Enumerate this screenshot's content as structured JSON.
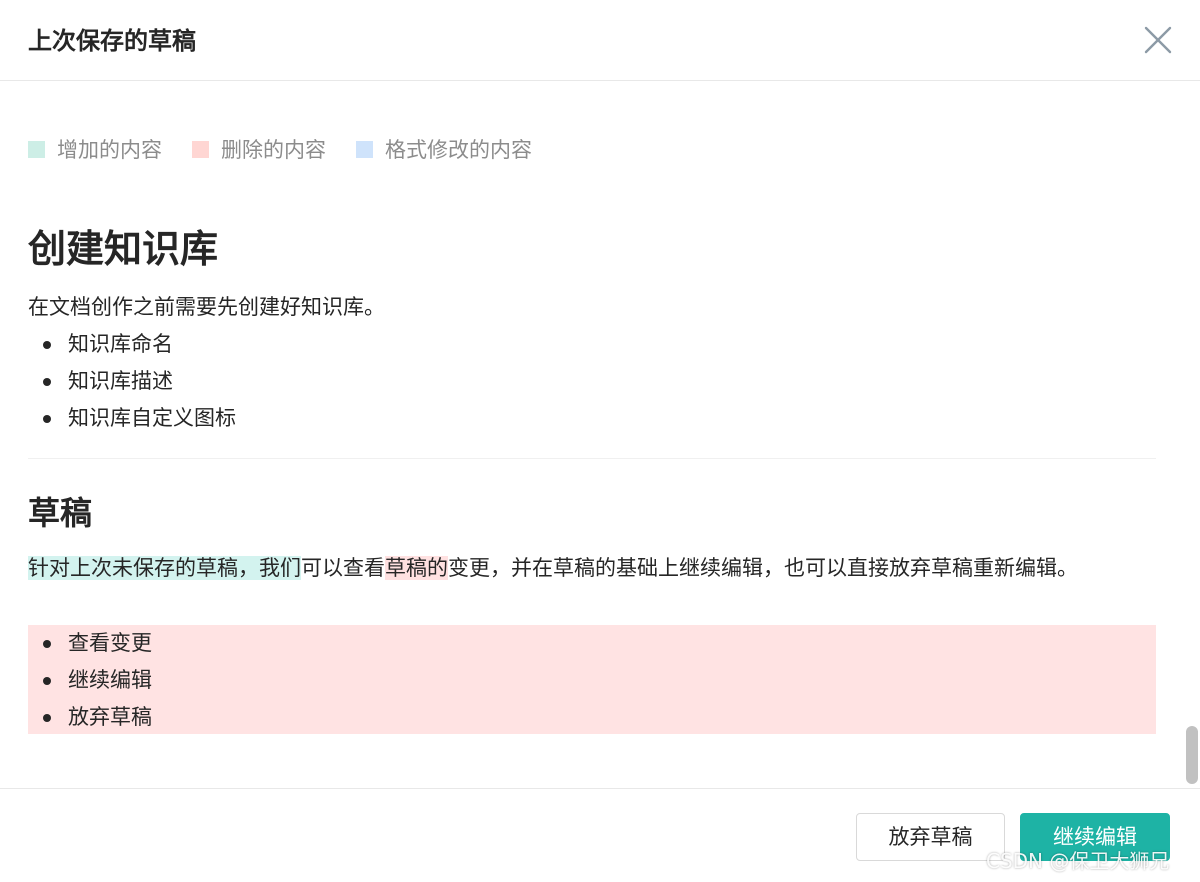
{
  "dialog": {
    "title": "上次保存的草稿",
    "close_icon": "close-icon"
  },
  "legend": [
    {
      "label": "增加的内容",
      "color": "#cdeee6"
    },
    {
      "label": "删除的内容",
      "color": "#ffd6d3"
    },
    {
      "label": "格式修改的内容",
      "color": "#cfe3fb"
    }
  ],
  "content": {
    "section1": {
      "heading": "创建知识库",
      "paragraph": "在文档创作之前需要先创建好知识库。",
      "items": [
        "知识库命名",
        "知识库描述",
        "知识库自定义图标"
      ]
    },
    "section2": {
      "heading": "草稿",
      "para_added": "针对上次未保存的草稿，我们",
      "para_normal1": "可以查看",
      "para_deleted": "草稿的",
      "para_normal2": "变更，并在草稿的基础上继续编辑，也可以直接放弃草稿重新编辑。",
      "deleted_items": [
        "查看变更",
        "继续编辑",
        "放弃草稿"
      ]
    }
  },
  "highlight_colors": {
    "added": "#d3f3ef",
    "deleted": "#ffe1e1"
  },
  "footer": {
    "discard_label": "放弃草稿",
    "continue_label": "继续编辑"
  },
  "accent_color": "#1eb3a5",
  "watermark": "CSDN @保卫大狮兄"
}
